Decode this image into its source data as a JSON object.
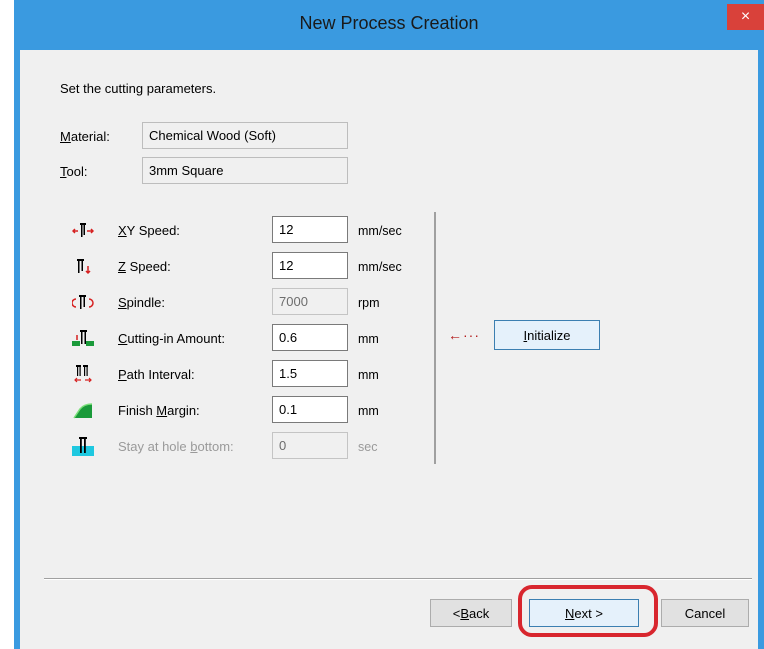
{
  "window": {
    "title": "New Process Creation",
    "close_label": "×"
  },
  "instruction": "Set the cutting parameters.",
  "material": {
    "label_u": "M",
    "label_rest": "aterial:",
    "value": "Chemical Wood (Soft)"
  },
  "tool": {
    "label_u": "T",
    "label_rest": "ool:",
    "value": "3mm Square"
  },
  "params": [
    {
      "pre": "",
      "u": "X",
      "post": "Y Speed:",
      "value": "12",
      "unit": "mm/sec",
      "icon": "xy-speed-icon",
      "enabled": true
    },
    {
      "pre": "",
      "u": "Z",
      "post": " Speed:",
      "value": "12",
      "unit": "mm/sec",
      "icon": "z-speed-icon",
      "enabled": true
    },
    {
      "pre": "",
      "u": "S",
      "post": "pindle:",
      "value": "7000",
      "unit": "rpm",
      "icon": "spindle-icon",
      "enabled": false
    },
    {
      "pre": "",
      "u": "C",
      "post": "utting-in Amount:",
      "value": "0.6",
      "unit": "mm",
      "icon": "cutting-in-icon",
      "enabled": true
    },
    {
      "pre": "",
      "u": "P",
      "post": "ath Interval:",
      "value": "1.5",
      "unit": "mm",
      "icon": "path-interval-icon",
      "enabled": true
    },
    {
      "pre": "Finish ",
      "u": "M",
      "post": "argin:",
      "value": "0.1",
      "unit": "mm",
      "icon": "finish-margin-icon",
      "enabled": true
    },
    {
      "pre": "Stay at hole ",
      "u": "b",
      "post": "ottom:",
      "value": "0",
      "unit": "sec",
      "icon": "stay-hole-bottom-icon",
      "enabled": false
    }
  ],
  "initialize": {
    "u": "I",
    "rest": "nitialize",
    "arrow": "←···"
  },
  "footer": {
    "back": {
      "pre": "< ",
      "u": "B",
      "post": "ack"
    },
    "next": {
      "u": "N",
      "post": "ext >"
    },
    "cancel": "Cancel"
  },
  "colors": {
    "title_bar": "#3a9ae0",
    "close_button": "#d9413a",
    "highlight_ring": "#d8262e",
    "icon_red": "#d62020",
    "icon_green": "#1a9a3a",
    "icon_cyan": "#1ec8e0"
  }
}
